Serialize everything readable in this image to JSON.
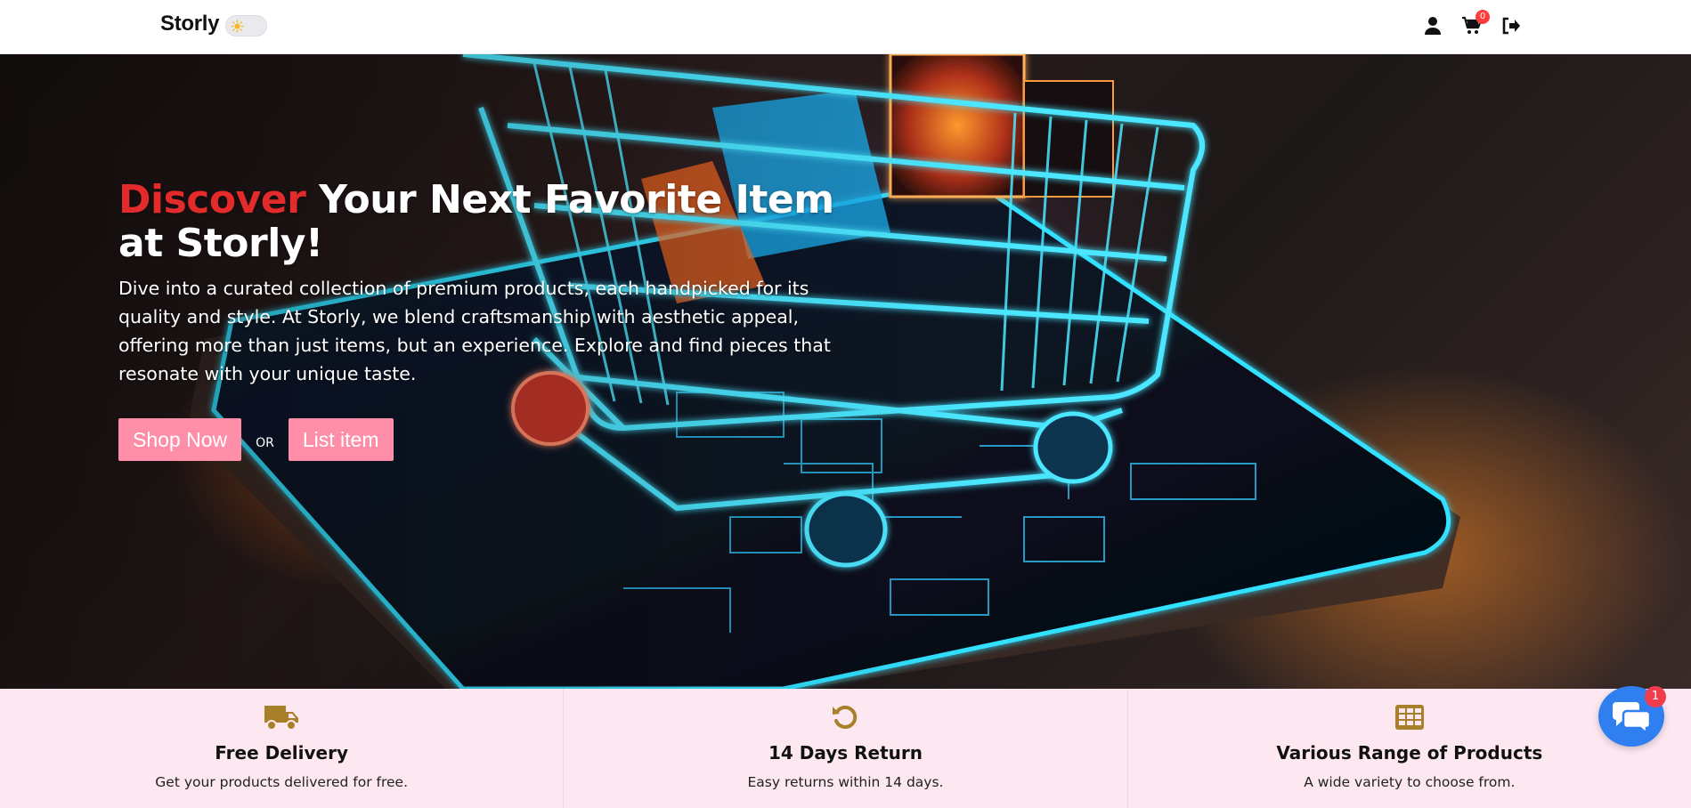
{
  "navbar": {
    "brand": "Storly",
    "cart_count": "0",
    "icons": [
      "user-icon",
      "cart-icon",
      "logout-icon"
    ]
  },
  "hero": {
    "title_accent": "Discover",
    "title_rest": " Your Next Favorite Item at Storly!",
    "description": "Dive into a curated collection of premium products, each handpicked for its quality and style. At Storly, we blend craftsmanship with aesthetic appeal, offering more than just items, but an experience. Explore and find pieces that resonate with your unique taste.",
    "shop_button": "Shop Now",
    "or_label": "OR",
    "list_button": "List item",
    "accent_color": "#e32b2b",
    "button_color": "#ff8fa8"
  },
  "features": [
    {
      "icon": "truck-icon",
      "title": "Free Delivery",
      "text": "Get your products delivered for free."
    },
    {
      "icon": "return-icon",
      "title": "14 Days Return",
      "text": "Easy returns within 14 days."
    },
    {
      "icon": "grid-icon",
      "title": "Various Range of Products",
      "text": "A wide variety to choose from."
    }
  ],
  "chat": {
    "badge": "1"
  },
  "colors": {
    "feature_icon": "#a8802a",
    "features_bg": "#fde8f2",
    "chat": "#2f7ff0"
  }
}
